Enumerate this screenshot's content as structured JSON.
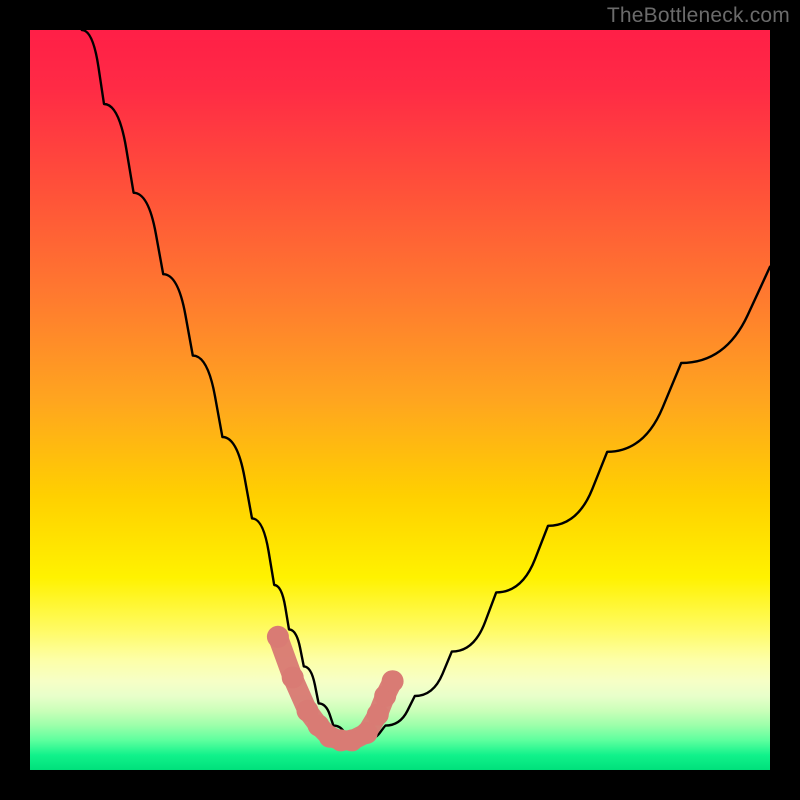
{
  "watermark": "TheBottleneck.com",
  "chart_data": {
    "type": "line",
    "title": "",
    "xlabel": "",
    "ylabel": "",
    "xlim": [
      0,
      100
    ],
    "ylim": [
      0,
      100
    ],
    "curve": {
      "name": "bottleneck-curve",
      "x": [
        7,
        10,
        14,
        18,
        22,
        26,
        30,
        33,
        35,
        37,
        39,
        41,
        43,
        45,
        48,
        52,
        57,
        63,
        70,
        78,
        88,
        100
      ],
      "y": [
        100,
        90,
        78,
        67,
        56,
        45,
        34,
        25,
        19,
        14,
        9,
        6,
        4,
        4,
        6,
        10,
        16,
        24,
        33,
        43,
        55,
        68
      ]
    },
    "highlight": {
      "name": "optimal-range",
      "color": "#d97b74",
      "x": [
        33.5,
        35.5,
        37.5,
        39.0,
        40.5,
        42.0,
        43.5,
        45.5,
        47.0,
        48.0,
        49.0
      ],
      "y": [
        18.0,
        12.5,
        8.0,
        6.0,
        4.5,
        4.0,
        4.0,
        5.0,
        7.5,
        10.0,
        12.0
      ]
    }
  }
}
